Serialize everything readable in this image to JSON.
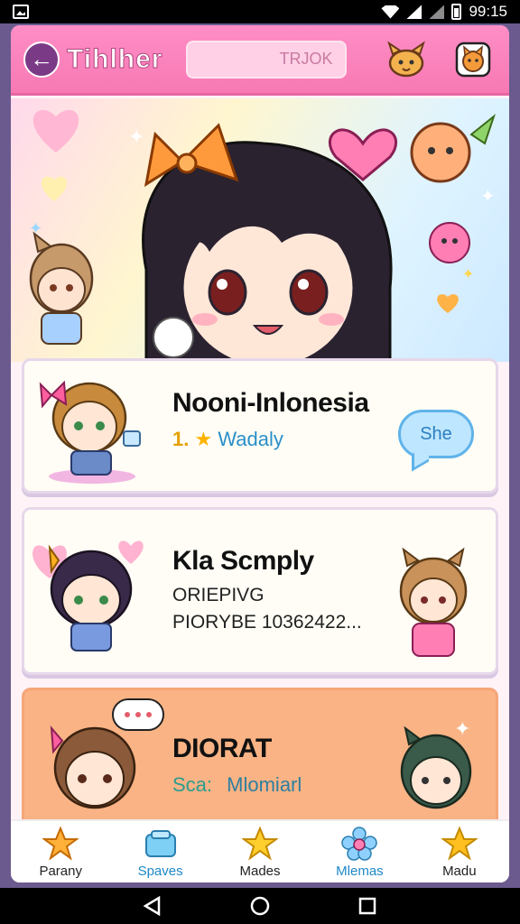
{
  "status_bar": {
    "time": "99:15"
  },
  "header": {
    "title": "Tihlher",
    "search_text": "TRJOK"
  },
  "cards": [
    {
      "title": "Nooni-Inlonesia",
      "rating": "1.",
      "subtitle": "Wadaly",
      "share_label": "She"
    },
    {
      "title": "Kla Scmply",
      "meta_line1": "ORIEPIVG",
      "meta_line2": "PIORYBE 10362422..."
    },
    {
      "title": "DIORAT",
      "accent": "Sca:",
      "subtitle": "Mlomiarl"
    }
  ],
  "bottom_nav": [
    {
      "label": "Parany",
      "icon": "star-icon"
    },
    {
      "label": "Spaves",
      "icon": "box-icon"
    },
    {
      "label": "Mades",
      "icon": "star-icon"
    },
    {
      "label": "Mlemas",
      "icon": "flower-icon"
    },
    {
      "label": "Madu",
      "icon": "star-icon"
    }
  ],
  "colors": {
    "header_pink": "#f779b4",
    "accent_blue": "#2a8fc9",
    "card3_bg": "#f9b385"
  }
}
